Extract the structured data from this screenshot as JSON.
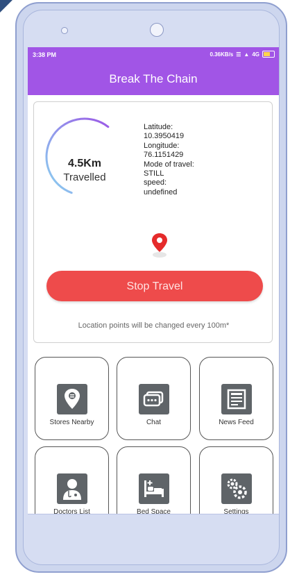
{
  "status_bar": {
    "time": "3:38 PM",
    "speed": "0.36KB/s",
    "network": "4G"
  },
  "app": {
    "title": "Break The Chain"
  },
  "travel": {
    "distance_value": "4.5Km",
    "distance_label": "Travelled",
    "progress_fraction": 0.55,
    "latitude_label": "Latitude:",
    "latitude_value": "10.3950419",
    "longitude_label": "Longitude:",
    "longitude_value": "76.1151429",
    "mode_label": "Mode of travel:",
    "mode_value": "STILL",
    "speed_label": "speed:",
    "speed_value": "undefined",
    "stop_button": "Stop Travel",
    "note": "Location points will be changed every 100m*"
  },
  "menu": {
    "items": [
      {
        "label": "Stores Nearby",
        "icon": "store-location-icon"
      },
      {
        "label": "Chat",
        "icon": "chat-icon"
      },
      {
        "label": "News Feed",
        "icon": "news-feed-icon"
      },
      {
        "label": "Doctors List",
        "icon": "doctor-icon"
      },
      {
        "label": "Bed Space",
        "icon": "bed-icon"
      },
      {
        "label": "Settings",
        "icon": "settings-gears-icon"
      }
    ]
  },
  "colors": {
    "appbar": "#a155e6",
    "stop_button": "#ee4b4b",
    "progress_start": "#8ad3f0",
    "progress_end": "#9b59e6",
    "pin": "#e52b2b",
    "tile_icon_bg": "#5f6468"
  }
}
